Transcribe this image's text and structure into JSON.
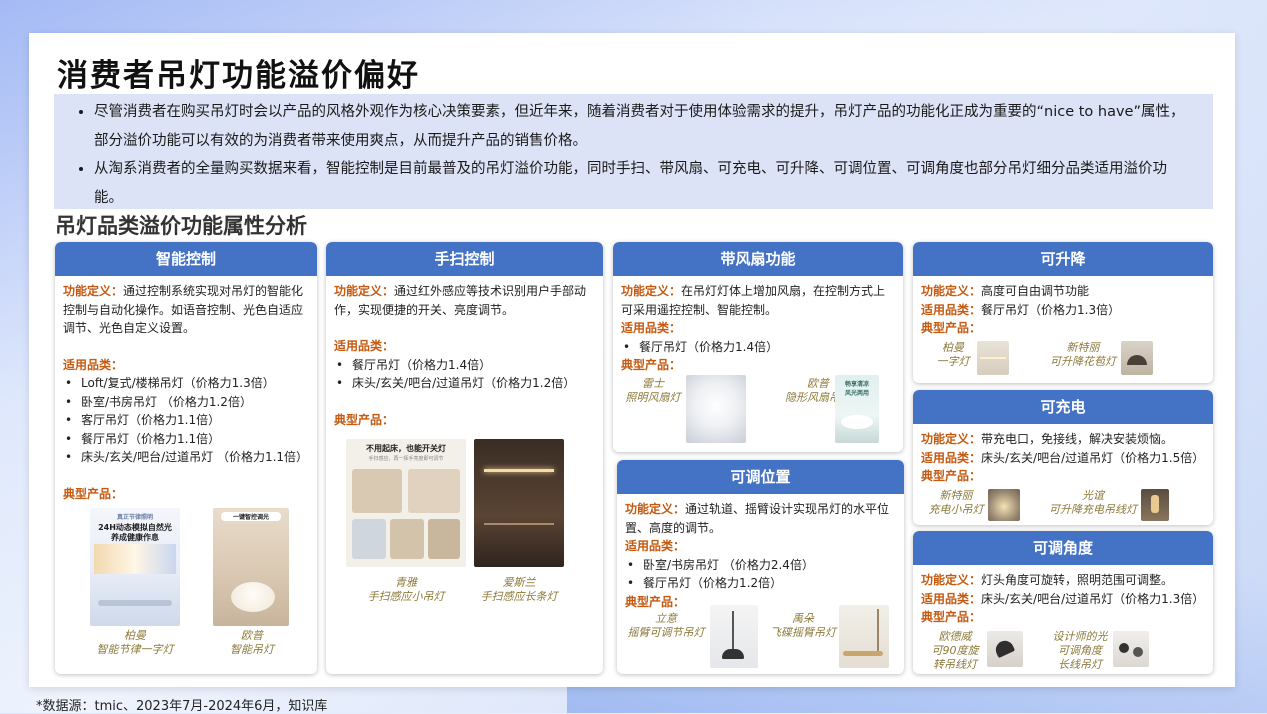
{
  "title": "消费者吊灯功能溢价偏好",
  "summary": [
    "尽管消费者在购买吊灯时会以产品的风格外观作为核心决策要素，但近年来，随着消费者对于使用体验需求的提升，吊灯产品的功能化正成为重要的“nice to have”属性，部分溢价功能可以有效的为消费者带来使用爽点，从而提升产品的销售价格。",
    "从淘系消费者的全量购买数据来看，智能控制是目前最普及的吊灯溢价功能，同时手扫、带风扇、可充电、可升降、可调位置、可调角度也部分吊灯细分品类适用溢价功能。"
  ],
  "subtitle": "吊灯品类溢价功能属性分析",
  "labels": {
    "def": "功能定义：",
    "cat": "适用品类：",
    "prod": "典型产品："
  },
  "cards": {
    "smart": {
      "title": "智能控制",
      "def": "通过控制系统实现对吊灯的智能化控制与自动化操作。如语音控制、光色自适应调节、光色自定义设置。",
      "cats": [
        "Loft/复式/楼梯吊灯（价格力1.3倍）",
        "卧室/书房吊灯 （价格力1.2倍）",
        "客厅吊灯（价格力1.1倍）",
        "餐厅吊灯（价格力1.1倍）",
        "床头/玄关/吧台/过道吊灯 （价格力1.1倍）"
      ],
      "products": [
        "柏曼\n智能节律一字灯",
        "欧普\n智能吊灯"
      ],
      "img_text": [
        "真正节律照明",
        "24H动态模拟自然光",
        "养成健康作息",
        "一键智控调光"
      ]
    },
    "hand": {
      "title": "手扫控制",
      "def": "通过红外感应等技术识别用户手部动作，实现便捷的开关、亮度调节。",
      "cats": [
        "餐厅吊灯（价格力1.4倍）",
        "床头/玄关/吧台/过道吊灯（价格力1.2倍）"
      ],
      "products": [
        "青雅\n手扫感应小吊灯",
        "爱斯兰\n手扫感应长条灯"
      ],
      "img_text": [
        "不用起床，也能开关灯",
        "手扫感应，再一挥手亮度即可调节"
      ]
    },
    "fan": {
      "title": "带风扇功能",
      "def": "在吊灯灯体上增加风扇，在控制方式上可采用遥控控制、智能控制。",
      "cats": [
        "餐厅吊灯（价格力1.4倍）"
      ],
      "products": [
        "雷士\n照明风扇灯",
        "欧普\n隐形风扇吊灯"
      ],
      "img_text": [
        "畅享清凉",
        "风光两用"
      ]
    },
    "lift": {
      "title": "可升降",
      "def": "高度可自由调节功能",
      "cats_inline": "餐厅吊灯（价格力1.3倍）",
      "products": [
        "柏曼\n一字灯",
        "新特丽\n可升降花苞灯"
      ]
    },
    "charge": {
      "title": "可充电",
      "def": "带充电口，免接线，解决安装烦恼。",
      "cats_inline": "床头/玄关/吧台/过道吊灯（价格力1.5倍）",
      "products": [
        "新特丽\n充电小吊灯",
        "光谊\n可升降充电吊线灯"
      ]
    },
    "pos": {
      "title": "可调位置",
      "def": "通过轨道、摇臂设计实现吊灯的水平位置、高度的调节。",
      "cats": [
        "卧室/书房吊灯 （价格力2.4倍）",
        "餐厅吊灯（价格力1.2倍）"
      ],
      "products": [
        "立意\n摇臂可调节吊灯",
        "禹朵\n飞碟摇臂吊灯"
      ]
    },
    "angle": {
      "title": "可调角度",
      "def": "灯头角度可旋转，照明范围可调整。",
      "cats_inline": "床头/玄关/吧台/过道吊灯（价格力1.3倍）",
      "products": [
        "欧德威\n可90度旋\n转吊线灯",
        "设计师的光\n可调角度\n长线吊灯"
      ]
    }
  },
  "source": "*数据源：tmic、2023年7月-2024年6月，知识库",
  "colors": {
    "header": "#4472c4",
    "label": "#c55a11",
    "caption": "#8c7a3a"
  }
}
